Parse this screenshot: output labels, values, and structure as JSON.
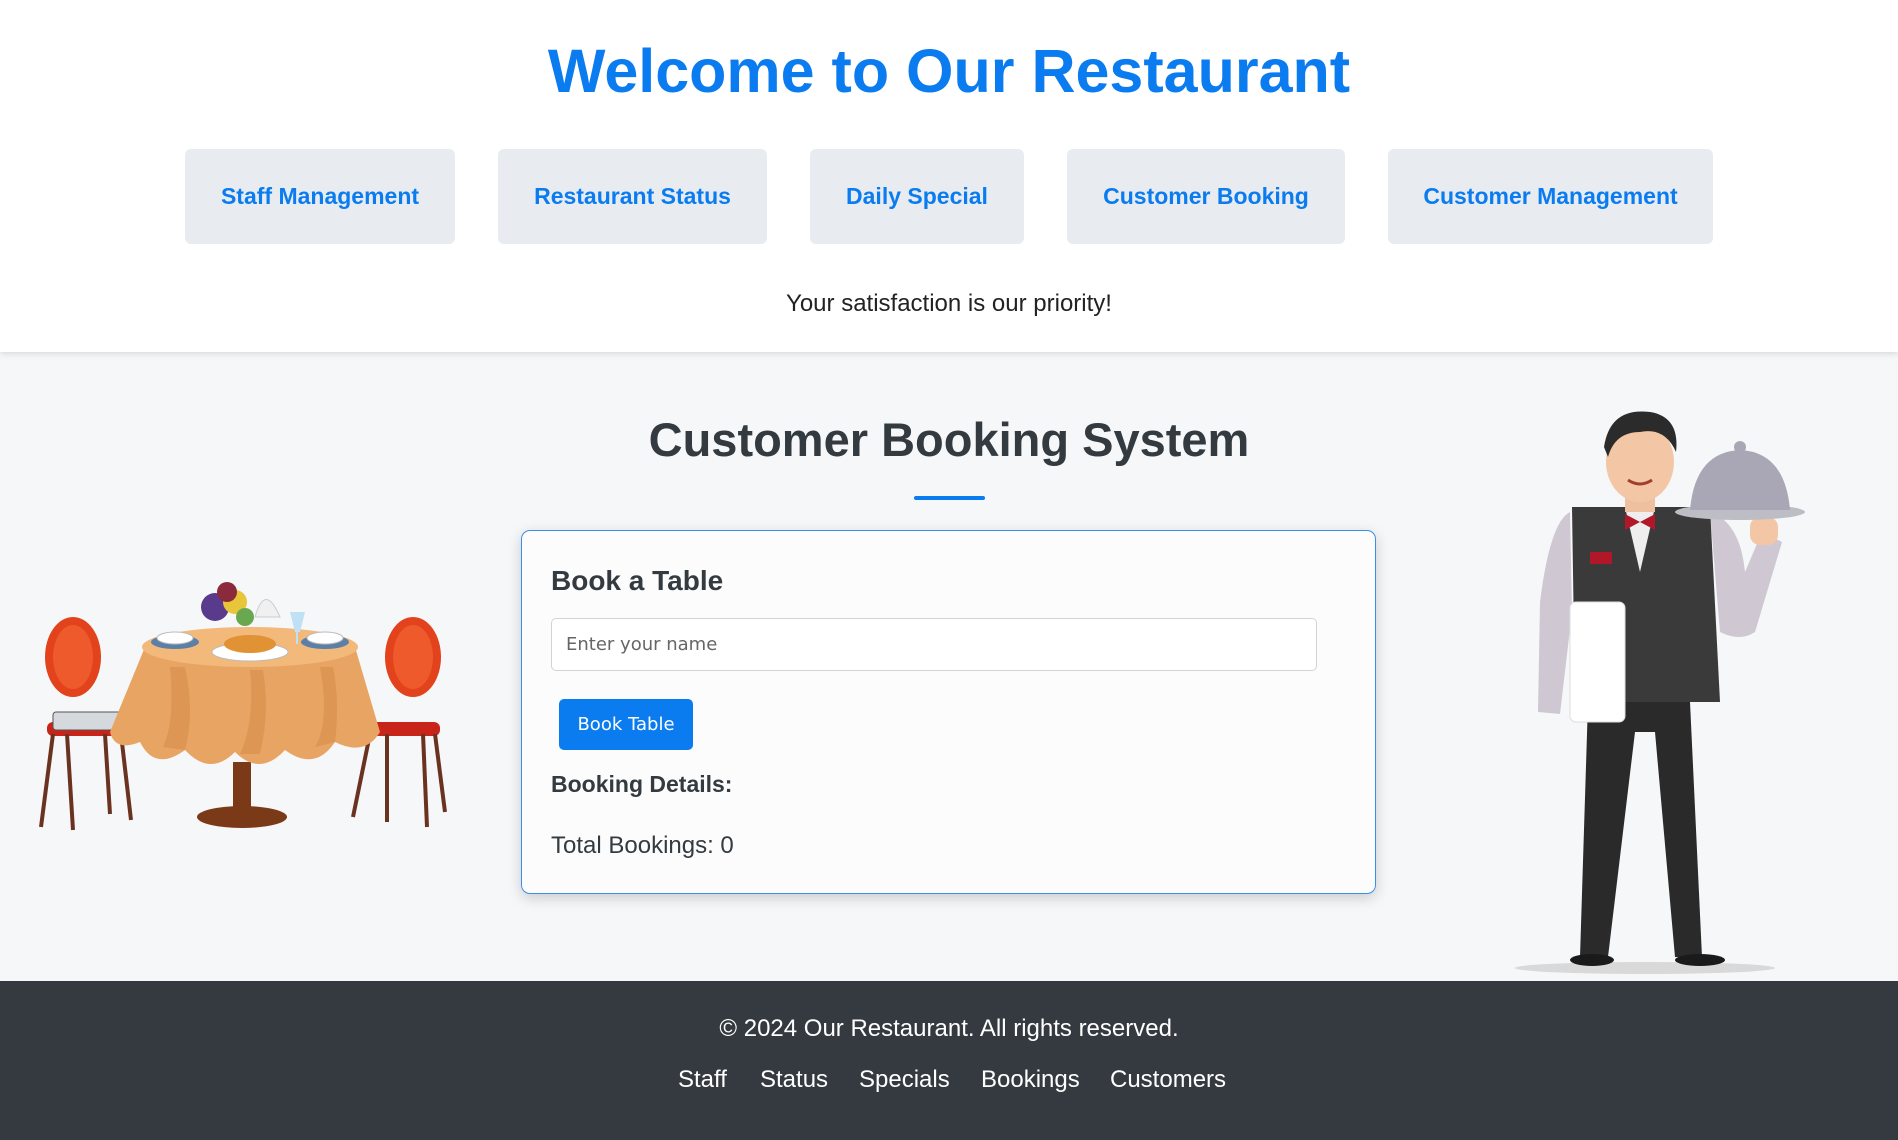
{
  "header": {
    "title": "Welcome to Our Restaurant",
    "tagline": "Your satisfaction is our priority!",
    "nav": [
      {
        "label": "Staff Management"
      },
      {
        "label": "Restaurant Status"
      },
      {
        "label": "Daily Special"
      },
      {
        "label": "Customer Booking"
      },
      {
        "label": "Customer Management"
      }
    ]
  },
  "main": {
    "section_title": "Customer Booking System",
    "card": {
      "title": "Book a Table",
      "name_placeholder": "Enter your name",
      "name_value": "",
      "book_button_label": "Book Table",
      "details_title": "Booking Details:",
      "total_bookings": "Total Bookings: 0"
    }
  },
  "footer": {
    "copyright": "© 2024 Our Restaurant. All rights reserved.",
    "links": [
      {
        "label": "Staff"
      },
      {
        "label": "Status"
      },
      {
        "label": "Specials"
      },
      {
        "label": "Bookings"
      },
      {
        "label": "Customers"
      }
    ]
  },
  "theme": {
    "accent": "#0a7cf0",
    "nav_bg": "#e8ecf0",
    "footer_bg": "#343a40",
    "main_bg": "#f6f7f9"
  }
}
